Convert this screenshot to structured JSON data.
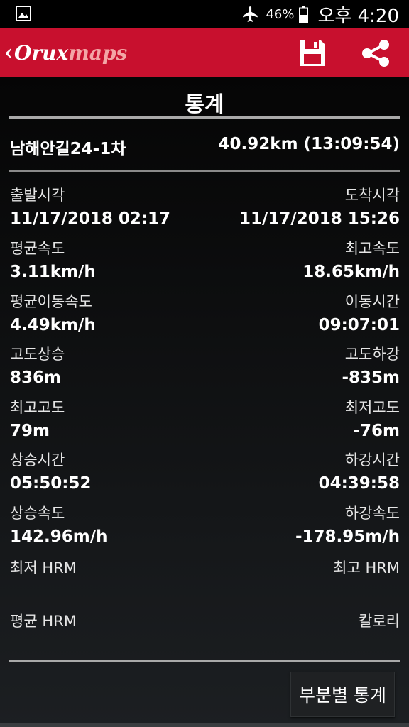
{
  "status_bar": {
    "battery_percent": "46%",
    "time": "오후 4:20",
    "icons": [
      "gallery-icon",
      "airplane-mode-icon",
      "battery-icon"
    ]
  },
  "app_bar": {
    "logo_part_a": "Orux",
    "logo_part_b": "maps",
    "back_glyph": "‹",
    "icons": [
      "save-icon",
      "share-icon"
    ],
    "accent_color": "#c8102e"
  },
  "screen": {
    "title": "통계"
  },
  "track": {
    "name": "남해안길24-1차",
    "total": "40.92km (13:09:54)"
  },
  "stats": [
    {
      "left_label": "출발시각",
      "left_value": "11/17/2018 02:17",
      "right_label": "도착시각",
      "right_value": "11/17/2018 15:26"
    },
    {
      "left_label": "평균속도",
      "left_value": "3.11km/h",
      "right_label": "최고속도",
      "right_value": "18.65km/h"
    },
    {
      "left_label": "평균이동속도",
      "left_value": "4.49km/h",
      "right_label": "이동시간",
      "right_value": "09:07:01"
    },
    {
      "left_label": "고도상승",
      "left_value": "836m",
      "right_label": "고도하강",
      "right_value": "-835m"
    },
    {
      "left_label": "최고고도",
      "left_value": "79m",
      "right_label": "최저고도",
      "right_value": "-76m"
    },
    {
      "left_label": "상승시간",
      "left_value": "05:50:52",
      "right_label": "하강시간",
      "right_value": "04:39:58"
    },
    {
      "left_label": "상승속도",
      "left_value": "142.96m/h",
      "right_label": "하강속도",
      "right_value": "-178.95m/h"
    },
    {
      "left_label": "최저 HRM",
      "left_value": "",
      "right_label": "최고 HRM",
      "right_value": ""
    },
    {
      "left_label": "평균 HRM",
      "left_value": "",
      "right_label": "칼로리",
      "right_value": ""
    }
  ],
  "actions": {
    "segment_stats_label": "부분별 통계"
  }
}
